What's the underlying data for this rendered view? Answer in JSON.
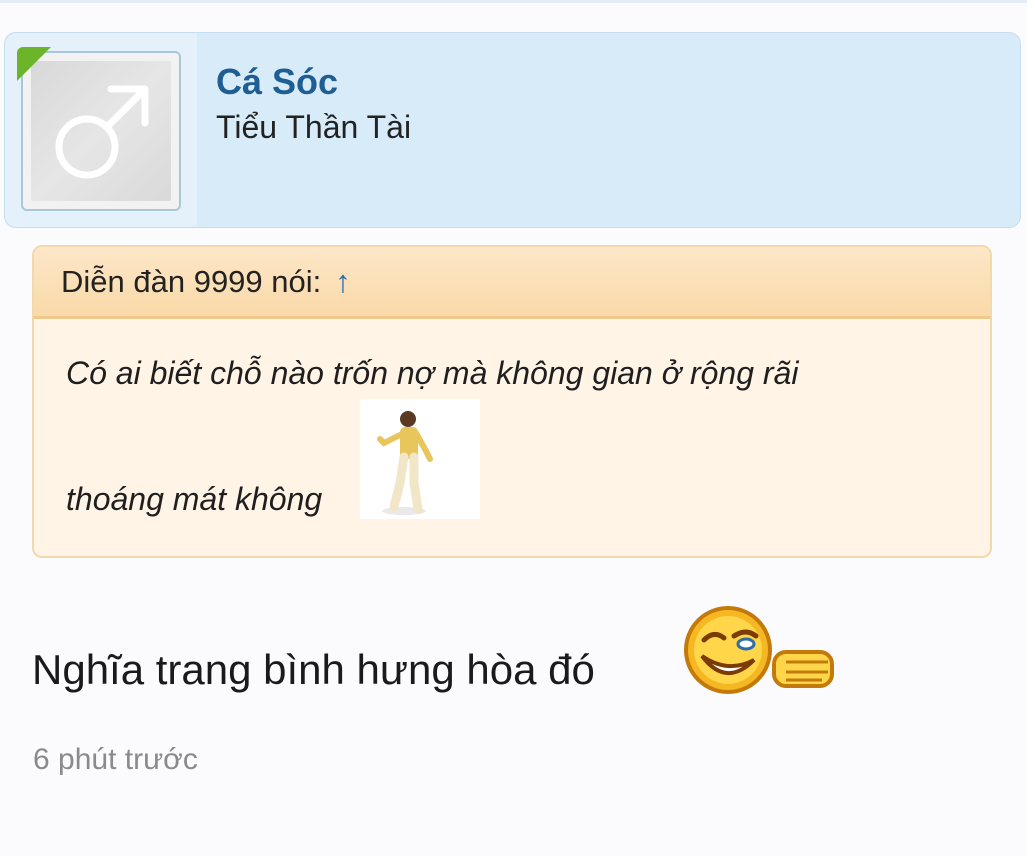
{
  "post": {
    "user": {
      "name": "Cá Sóc",
      "title": "Tiểu Thần Tài",
      "avatar_icon": "male-symbol-icon",
      "online_color": "#6cb52a",
      "name_color": "#1f5e92"
    },
    "quote": {
      "author": "Diễn đàn 9999 nói:",
      "jump_icon": "↑",
      "line1": "Có ai biết chỗ nào trốn nợ mà không gian ở rộng rãi",
      "line2": "thoáng mát không",
      "image_icon": "dancing-man-icon"
    },
    "message": "Nghĩa trang bình hưng hòa đó",
    "emoji_icon": "smirk-thumbs-emoji",
    "time": "6 phút trước"
  }
}
